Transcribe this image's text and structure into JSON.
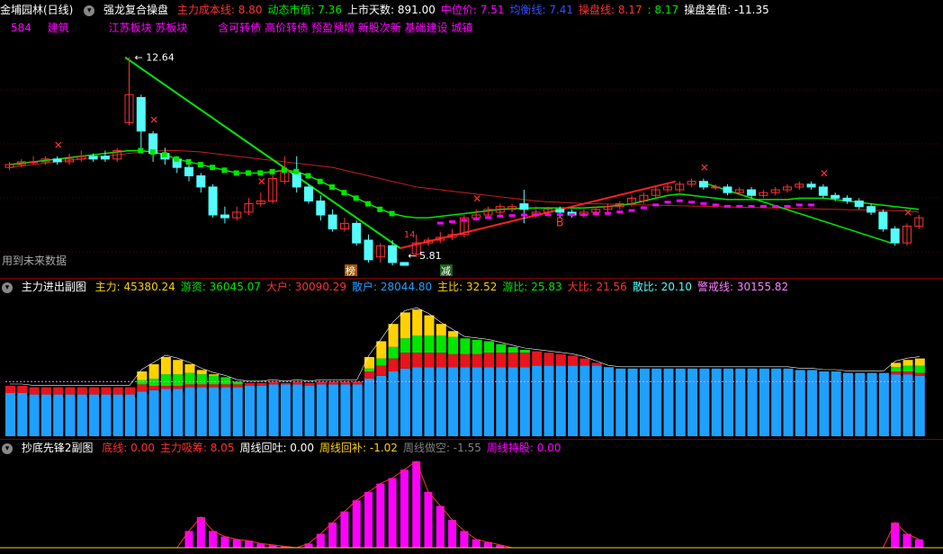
{
  "colors": {
    "up": "#ff3232",
    "down": "#54fcfc",
    "green": "#00e600",
    "pink": "#ff00ff",
    "yellow": "#ffd200",
    "blue": "#1ea0ff",
    "white": "#ffffff"
  },
  "main": {
    "title": "金埔园林(日线)",
    "indicator": "强龙复合操盘",
    "fields": [
      {
        "label": "主力成本线:",
        "value": "8.80",
        "color": "#ff3232"
      },
      {
        "label": "动态市值:",
        "value": "7.36",
        "color": "#00e600"
      },
      {
        "label": "上市天数:",
        "value": "891.00",
        "color": "#ffffff"
      },
      {
        "label": "中位价:",
        "value": "7.51",
        "color": "#ff00ff"
      },
      {
        "label": "均衡线:",
        "value": "7.41",
        "color": "#3050ff"
      },
      {
        "label": "操盘线:",
        "value": "8.17",
        "color": "#ff3232"
      },
      {
        "label": ":",
        "value": "8.17",
        "color": "#00e600"
      },
      {
        "label": "操盘差值:",
        "value": "-11.35",
        "color": "#ffffff"
      }
    ],
    "tags": [
      "584",
      "建筑",
      "江苏板块",
      "苏板块",
      "含可转债",
      "高价转债",
      "预盈预增",
      "新股次新",
      "基础建设",
      "城镇"
    ],
    "high_label": "12.64",
    "low_label": "5.81",
    "future_label": "用到未来数据",
    "mark_b": "B",
    "mark_bang": "榜",
    "mark_jian": "减",
    "mark_14": "14"
  },
  "sub1": {
    "title": "主力进出副图",
    "fields": [
      {
        "label": "主力:",
        "value": "45380.24",
        "color": "#ffd200"
      },
      {
        "label": "游资:",
        "value": "36045.07",
        "color": "#00e600"
      },
      {
        "label": "大户:",
        "value": "30090.29",
        "color": "#ff3232"
      },
      {
        "label": "散户:",
        "value": "28044.80",
        "color": "#1ea0ff"
      },
      {
        "label": "主比:",
        "value": "32.52",
        "color": "#ffd200"
      },
      {
        "label": "游比:",
        "value": "25.83",
        "color": "#00e600"
      },
      {
        "label": "大比:",
        "value": "21.56",
        "color": "#ff3232"
      },
      {
        "label": "散比:",
        "value": "20.10",
        "color": "#54fcfc"
      },
      {
        "label": "警戒线:",
        "value": "30155.82",
        "color": "#ff80ff"
      }
    ]
  },
  "sub2": {
    "title": "抄底先锋2副图",
    "fields": [
      {
        "label": "底线:",
        "value": "0.00",
        "color": "#ff3232"
      },
      {
        "label": "主力吸筹:",
        "value": "8.05",
        "color": "#ff3232"
      },
      {
        "label": "周线回吐:",
        "value": "0.00",
        "color": "#ffffff"
      },
      {
        "label": "周线回补:",
        "value": "-1.02",
        "color": "#ffd200"
      },
      {
        "label": "周线做空:",
        "value": "-1.55",
        "color": "#808080"
      },
      {
        "label": "周线持股:",
        "value": "0.00",
        "color": "#ff00ff"
      }
    ]
  },
  "chart_data": [
    {
      "type": "candlestick",
      "title": "金埔园林(日线)",
      "ylim": [
        5.2,
        13.4
      ],
      "bars": [
        [
          8.7,
          8.8,
          8.9,
          8.6
        ],
        [
          8.8,
          8.9,
          9.0,
          8.7
        ],
        [
          8.9,
          8.9,
          9.1,
          8.8
        ],
        [
          8.9,
          9.0,
          9.1,
          8.8
        ],
        [
          9.0,
          8.9,
          9.1,
          8.8
        ],
        [
          8.9,
          9.0,
          9.2,
          8.8
        ],
        [
          9.0,
          9.1,
          9.3,
          8.9
        ],
        [
          9.1,
          9.0,
          9.2,
          8.9
        ],
        [
          9.1,
          9.0,
          9.3,
          8.9
        ],
        [
          9.0,
          9.3,
          9.4,
          8.9
        ],
        [
          10.3,
          11.3,
          12.64,
          10.2
        ],
        [
          11.2,
          10.0,
          11.3,
          9.4
        ],
        [
          9.9,
          9.2,
          10.0,
          8.9
        ],
        [
          9.2,
          9.0,
          9.4,
          8.8
        ],
        [
          9.0,
          8.7,
          9.1,
          8.5
        ],
        [
          8.7,
          8.4,
          8.8,
          8.2
        ],
        [
          8.4,
          8.0,
          8.5,
          7.8
        ],
        [
          8.0,
          7.0,
          8.1,
          6.9
        ],
        [
          7.0,
          6.9,
          7.3,
          6.7
        ],
        [
          6.9,
          7.1,
          7.3,
          6.8
        ],
        [
          7.1,
          7.4,
          7.6,
          7.0
        ],
        [
          7.4,
          7.5,
          7.8,
          7.3
        ],
        [
          7.5,
          8.3,
          8.5,
          7.4
        ],
        [
          8.2,
          8.6,
          9.1,
          8.1
        ],
        [
          8.5,
          8.0,
          9.1,
          7.8
        ],
        [
          8.0,
          7.5,
          8.1,
          7.4
        ],
        [
          7.5,
          7.0,
          7.7,
          6.8
        ],
        [
          7.0,
          6.5,
          7.2,
          6.4
        ],
        [
          6.5,
          6.7,
          6.9,
          6.4
        ],
        [
          6.7,
          6.0,
          6.8,
          5.9
        ],
        [
          6.1,
          5.4,
          6.3,
          5.3
        ],
        [
          5.5,
          5.9,
          6.0,
          5.3
        ],
        [
          5.9,
          5.3,
          6.1,
          5.2
        ],
        [
          5.3,
          5.2,
          5.81,
          5.81
        ],
        [
          5.6,
          6.0,
          6.3,
          5.5
        ],
        [
          6.0,
          6.1,
          6.2,
          5.9
        ],
        [
          6.1,
          6.2,
          6.4,
          6.0
        ],
        [
          6.2,
          6.3,
          6.5,
          6.1
        ],
        [
          6.3,
          6.9,
          7.0,
          6.2
        ],
        [
          6.9,
          7.0,
          7.2,
          6.8
        ],
        [
          7.0,
          7.2,
          7.3,
          6.9
        ],
        [
          7.1,
          7.3,
          7.4,
          7.0
        ],
        [
          7.2,
          7.3,
          7.4,
          7.1
        ],
        [
          7.4,
          7.2,
          7.9,
          6.7
        ],
        [
          7.0,
          7.1,
          7.3,
          6.9
        ],
        [
          7.1,
          7.2,
          7.3,
          7.0
        ],
        [
          7.2,
          7.1,
          7.3,
          6.9
        ],
        [
          7.1,
          7.0,
          7.2,
          6.9
        ],
        [
          7.0,
          7.1,
          7.2,
          6.9
        ],
        [
          7.1,
          7.2,
          7.3,
          7.0
        ],
        [
          7.2,
          7.3,
          7.4,
          7.1
        ],
        [
          7.3,
          7.4,
          7.5,
          7.2
        ],
        [
          7.4,
          7.6,
          7.7,
          7.3
        ],
        [
          7.5,
          7.7,
          7.8,
          7.4
        ],
        [
          7.7,
          7.9,
          8.0,
          7.6
        ],
        [
          7.9,
          8.0,
          8.1,
          7.8
        ],
        [
          7.9,
          8.1,
          8.2,
          7.8
        ],
        [
          8.1,
          8.2,
          8.3,
          8.0
        ],
        [
          8.2,
          8.0,
          8.3,
          7.9
        ],
        [
          8.0,
          8.0,
          8.1,
          7.9
        ],
        [
          8.0,
          7.8,
          8.1,
          7.7
        ],
        [
          7.8,
          7.9,
          8.0,
          7.7
        ],
        [
          7.9,
          7.7,
          8.0,
          7.6
        ],
        [
          7.7,
          7.8,
          7.9,
          7.6
        ],
        [
          7.8,
          7.9,
          8.0,
          7.7
        ],
        [
          7.9,
          8.0,
          8.1,
          7.8
        ],
        [
          8.0,
          8.1,
          8.2,
          7.9
        ],
        [
          8.1,
          8.0,
          8.2,
          7.9
        ],
        [
          8.0,
          7.7,
          8.1,
          7.6
        ],
        [
          7.7,
          7.6,
          7.8,
          7.5
        ],
        [
          7.6,
          7.5,
          7.7,
          7.4
        ],
        [
          7.5,
          7.3,
          7.6,
          7.2
        ],
        [
          7.3,
          7.1,
          7.4,
          7.0
        ],
        [
          7.1,
          6.5,
          7.2,
          6.4
        ],
        [
          6.5,
          6.0,
          6.6,
          5.9
        ],
        [
          6.0,
          6.6,
          6.7,
          5.9
        ],
        [
          6.6,
          6.9,
          7.0,
          6.5
        ]
      ],
      "ma_red": [
        8.7,
        8.75,
        8.8,
        8.85,
        8.9,
        8.95,
        9.0,
        9.05,
        9.1,
        9.15,
        9.2,
        9.25,
        9.28,
        9.3,
        9.3,
        9.28,
        9.25,
        9.2,
        9.15,
        9.1,
        9.05,
        9.0,
        8.95,
        8.9,
        8.85,
        8.8,
        8.75,
        8.7,
        8.6,
        8.5,
        8.4,
        8.3,
        8.2,
        8.1,
        8.0,
        7.95,
        7.9,
        7.85,
        7.8,
        7.75,
        7.7,
        7.65,
        7.6,
        7.55,
        7.5,
        7.47,
        7.45,
        7.43,
        7.41,
        7.4,
        7.39,
        7.38,
        7.37,
        7.36,
        7.35,
        7.34,
        7.33,
        7.32,
        7.31,
        7.3,
        7.29,
        7.28,
        7.27,
        7.26,
        7.25,
        7.24,
        7.23,
        7.22,
        7.21,
        7.2,
        7.19,
        7.18,
        7.17,
        7.16,
        7.15,
        7.14,
        7.1
      ],
      "ma_green": [
        8.8,
        8.85,
        8.9,
        8.95,
        9.0,
        9.05,
        9.1,
        9.15,
        9.2,
        9.25,
        9.3,
        9.3,
        9.25,
        9.15,
        9.0,
        8.9,
        8.8,
        8.7,
        8.6,
        8.5,
        8.5,
        8.5,
        8.55,
        8.6,
        8.55,
        8.4,
        8.2,
        8.0,
        7.8,
        7.6,
        7.4,
        7.2,
        7.05,
        6.95,
        6.9,
        6.9,
        6.95,
        7.0,
        7.05,
        7.1,
        7.15,
        7.2,
        7.22,
        7.24,
        7.25,
        7.25,
        7.25,
        7.25,
        7.25,
        7.28,
        7.3,
        7.35,
        7.4,
        7.5,
        7.6,
        7.7,
        7.75,
        7.7,
        7.65,
        7.6,
        7.55,
        7.55,
        7.55,
        7.55,
        7.55,
        7.55,
        7.6,
        7.6,
        7.6,
        7.55,
        7.5,
        7.45,
        7.4,
        7.35,
        7.3,
        7.25,
        7.2
      ]
    },
    {
      "type": "bar",
      "title": "主力进出副图",
      "stacked": true,
      "series": [
        {
          "name": "散户",
          "values": [
            30,
            30,
            29,
            29,
            29,
            29,
            29,
            29,
            29,
            29,
            29,
            31,
            32,
            33,
            33,
            34,
            34,
            34,
            34,
            34,
            35,
            35,
            36,
            36,
            36,
            35,
            36,
            36,
            36,
            36,
            40,
            42,
            45,
            47,
            48,
            48,
            48,
            48,
            48,
            48,
            48,
            48,
            48,
            48,
            49,
            49,
            49,
            49,
            49,
            49,
            48,
            47,
            47,
            47,
            47,
            47,
            47,
            47,
            47,
            47,
            47,
            47,
            47,
            47,
            47,
            47,
            46,
            46,
            45,
            45,
            44,
            44,
            44,
            44,
            43,
            43,
            42
          ]
        },
        {
          "name": "大户",
          "values": [
            5,
            5,
            5,
            5,
            5,
            5,
            5,
            5,
            5,
            5,
            5,
            5,
            3,
            2,
            2,
            2,
            2,
            2,
            2,
            2,
            2,
            2,
            2,
            1,
            2,
            2,
            2,
            2,
            2,
            2,
            5,
            7,
            9,
            11,
            10,
            10,
            10,
            9,
            9,
            9,
            10,
            10,
            10,
            10,
            10,
            9,
            8,
            7,
            5,
            2,
            0,
            0,
            0,
            0,
            0,
            0,
            0,
            0,
            0,
            0,
            0,
            0,
            0,
            0,
            0,
            0,
            0,
            0,
            0,
            0,
            0,
            0,
            0,
            0,
            2,
            2,
            2
          ]
        },
        {
          "name": "游资",
          "values": [
            0,
            0,
            0,
            0,
            0,
            0,
            0,
            0,
            0,
            0,
            0,
            3,
            5,
            8,
            8,
            8,
            7,
            6,
            5,
            2,
            0,
            0,
            0,
            0,
            0,
            0,
            0,
            0,
            0,
            0,
            2,
            5,
            8,
            10,
            12,
            12,
            12,
            12,
            11,
            10,
            8,
            6,
            4,
            2,
            0,
            0,
            0,
            0,
            0,
            0,
            0,
            0,
            0,
            0,
            0,
            0,
            0,
            0,
            0,
            0,
            0,
            0,
            0,
            0,
            0,
            0,
            0,
            0,
            0,
            0,
            0,
            0,
            0,
            0,
            3,
            4,
            5
          ]
        },
        {
          "name": "主力",
          "values": [
            0,
            0,
            0,
            0,
            0,
            0,
            0,
            0,
            0,
            0,
            0,
            6,
            10,
            12,
            10,
            6,
            3,
            1,
            0,
            0,
            0,
            0,
            0,
            0,
            0,
            0,
            0,
            0,
            0,
            0,
            8,
            12,
            16,
            18,
            18,
            14,
            8,
            4,
            0,
            0,
            0,
            0,
            0,
            0,
            0,
            0,
            0,
            0,
            0,
            0,
            0,
            0,
            0,
            0,
            0,
            0,
            0,
            0,
            0,
            0,
            0,
            0,
            0,
            0,
            0,
            0,
            0,
            0,
            0,
            0,
            0,
            0,
            0,
            0,
            3,
            4,
            5
          ]
        }
      ]
    },
    {
      "type": "bar",
      "title": "抄底先锋2副图",
      "series": [
        {
          "name": "主力吸筹",
          "values": [
            0,
            0,
            0,
            0,
            0,
            0,
            0,
            0,
            0,
            0,
            0,
            0,
            0,
            0,
            0,
            2,
            3,
            2,
            1,
            0,
            0,
            0,
            0,
            0,
            0,
            0,
            0,
            0,
            0,
            0,
            0,
            0,
            0,
            0,
            0,
            2,
            3,
            2,
            1,
            0,
            0,
            0,
            0,
            0,
            0,
            0,
            0,
            0,
            0,
            0,
            0,
            0,
            0,
            0,
            0,
            0,
            0,
            0,
            0,
            0,
            0,
            0,
            0,
            0,
            0,
            0,
            0,
            0,
            0,
            0,
            0,
            0,
            0,
            0,
            0,
            0,
            0
          ]
        },
        {
          "name": "magenta",
          "values": [
            0,
            0,
            0,
            0,
            0,
            0,
            0,
            0,
            0,
            0,
            0,
            0,
            0,
            0,
            0,
            0,
            0,
            0,
            0,
            0,
            0,
            0,
            0,
            0,
            0,
            0,
            0,
            0,
            0,
            0,
            0,
            0,
            0,
            0,
            0,
            0,
            0,
            0,
            0,
            0,
            0,
            0,
            0,
            0,
            0,
            0,
            0,
            0,
            0,
            0,
            0,
            0,
            0,
            0,
            0,
            0,
            0,
            0,
            0,
            0,
            0,
            0,
            0,
            0,
            0,
            0,
            0,
            0,
            0,
            0,
            0,
            0,
            0,
            0,
            0,
            0,
            0
          ]
        }
      ]
    }
  ]
}
